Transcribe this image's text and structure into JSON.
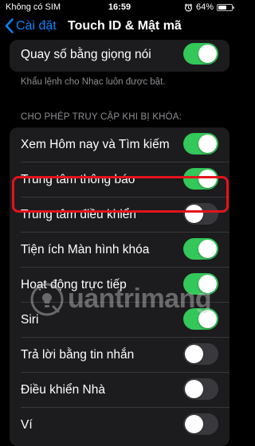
{
  "status_bar": {
    "carrier": "Không có SIM",
    "time": "16:59",
    "battery_percent": "64%",
    "battery_level": 0.64,
    "icons": [
      "alarm-icon",
      "battery-icon"
    ]
  },
  "nav": {
    "back_label": "Cài đặt",
    "title": "Touch ID & Mật mã",
    "back_icon": "chevron-left-icon"
  },
  "voice": {
    "label": "Quay số bằng giọng nói",
    "on": true,
    "note": "Khẩu lệnh cho Nhạc luôn được bật."
  },
  "locked_access": {
    "header": "CHO PHÉP TRUY CẬP KHI BỊ KHÓA:",
    "items": [
      {
        "label": "Xem Hôm nay và Tìm kiếm",
        "on": true
      },
      {
        "label": "Trung tâm thông báo",
        "on": true
      },
      {
        "label": "Trung tâm điều khiển",
        "on": false
      },
      {
        "label": "Tiện ích Màn hình khóa",
        "on": true
      },
      {
        "label": "Hoạt động trực tiếp",
        "on": true
      },
      {
        "label": "Siri",
        "on": true
      },
      {
        "label": "Trả lời bằng tin nhắn",
        "on": false
      },
      {
        "label": "Điều khiển Nhà",
        "on": false
      },
      {
        "label": "Ví",
        "on": false
      }
    ]
  },
  "colors": {
    "accent": "#0a84ff",
    "toggle_on": "#34c759",
    "toggle_off": "#39393d",
    "highlight": "#e3131b"
  },
  "watermark": {
    "text": "uantrimang",
    "icon": "bulb-icon"
  }
}
